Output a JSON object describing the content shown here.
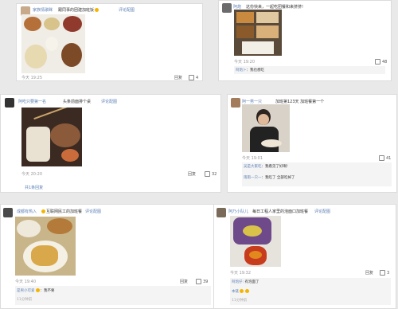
{
  "comments": [
    {
      "user": "家族情歌眯",
      "text": "跟同事的团建加班饭",
      "emoji": "emoji-icon",
      "link": "评论配图",
      "time": "今天 19:25",
      "reply": "回复",
      "likes": "4"
    },
    {
      "user": "阿炮",
      "text": "这份快来，一起吃团餐和来挤挤!",
      "link": "",
      "time": "今天 19:20",
      "reply": "回复",
      "likes": "48",
      "sub_replies": [
        {
          "name": "阿炮卜",
          "text": "我也想吃"
        }
      ]
    },
    {
      "user": "阿吃只要第一名",
      "text": "头条前面排个桌",
      "link": "评论配图",
      "time": "今天 20:20",
      "reply": "回复",
      "likes": "32",
      "more": "共1条回复"
    },
    {
      "user": "阿一男一只",
      "text": "加班第123天 加班餐第一个",
      "link": "",
      "time": "今天 19:01",
      "reply": "回复",
      "likes": "41",
      "sub_replies": [
        {
          "name": "吴是大家吃",
          "text": "我看见了好啊!"
        },
        {
          "name": "雨雨一只一",
          "text": "我吃了 全部吃掉了"
        }
      ]
    },
    {
      "user": "成都有热入",
      "text": "互联网民工的加班餐",
      "link": "评论配图",
      "time": "今天 19:40",
      "reply": "回复",
      "likes": "39",
      "sub_replies": [
        {
          "name": "是男小可爱",
          "text": "我不要"
        }
      ],
      "sub_time": "11分钟前"
    },
    {
      "user": "阿乃小队儿",
      "text": "每日工程人家里的泡面口加班餐",
      "link": "评论配图",
      "time": "今天 19:32",
      "reply": "回复",
      "likes": "3",
      "sub_replies": [
        {
          "name": "阿炮仔:",
          "text": "有泡面了"
        },
        {
          "name": "本链",
          "text": ""
        }
      ],
      "sub_time": "11分钟前"
    }
  ]
}
